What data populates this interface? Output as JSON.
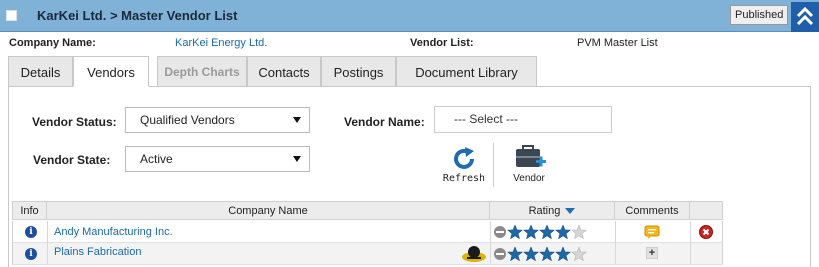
{
  "header": {
    "title": "KarKei Ltd. > Master Vendor List",
    "published_label": "Published"
  },
  "info": {
    "company_label": "Company Name:",
    "company_value": "KarKei Energy Ltd.",
    "list_label": "Vendor List:",
    "list_value": "PVM Master List"
  },
  "tabs": [
    {
      "label": "Details",
      "state": "normal"
    },
    {
      "label": "Vendors",
      "state": "active"
    },
    {
      "label": "Depth Charts",
      "state": "disabled"
    },
    {
      "label": "Contacts",
      "state": "normal"
    },
    {
      "label": "Postings",
      "state": "normal"
    },
    {
      "label": "Document Library",
      "state": "normal"
    }
  ],
  "filters": {
    "status_label": "Vendor Status:",
    "status_value": "Qualified Vendors",
    "state_label": "Vendor State:",
    "state_value": "Active",
    "name_label": "Vendor Name:",
    "name_value": "--- Select ---"
  },
  "actions": {
    "refresh_label": "Refresh",
    "vendor_label": "Vendor"
  },
  "table": {
    "columns": [
      "Info",
      "Company Name",
      "Rating",
      "Comments"
    ],
    "rows": [
      {
        "company": "Andy Manufacturing Inc.",
        "rating": 4,
        "comment_icon": "comment-note-icon",
        "has_remove": true
      },
      {
        "company": "Plains Fabrication",
        "rating": 4,
        "comment_icon": "plus-icon",
        "has_remove": false,
        "has_badge": true
      }
    ]
  },
  "colors": {
    "titlebar": "#7fb2d6",
    "accent": "#1f5ea8",
    "link": "#1b6aa5",
    "star": "#1e6aa8"
  }
}
